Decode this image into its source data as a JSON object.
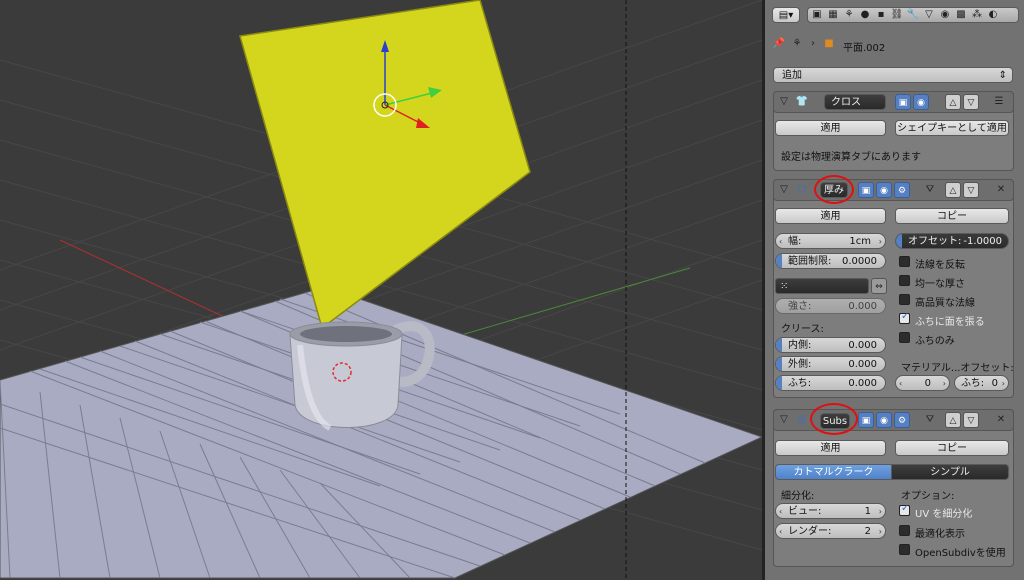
{
  "object_name": "平面.002",
  "add_modifier_label": "追加",
  "cloth": {
    "name": "クロス",
    "apply": "適用",
    "apply_shapekey": "シェイプキーとして適用",
    "note": "設定は物理演算タブにあります"
  },
  "solidify": {
    "name": "厚み",
    "apply": "適用",
    "copy": "コピー",
    "width_label": "幅:",
    "width_value": "1cm",
    "offset_label": "オフセット:",
    "offset_value": "-1.0000",
    "clamp_label": "範囲制限:",
    "clamp_value": "0.0000",
    "vgroup_value": "",
    "strength_label": "強さ:",
    "strength_value": "0.000",
    "crease_label": "クリース:",
    "inner_label": "内側:",
    "inner_value": "0.000",
    "outer_label": "外側:",
    "outer_value": "0.000",
    "rim_label": "ふち:",
    "rim_value": "0.000",
    "flip_normals": "法線を反転",
    "even_thickness": "均一な厚さ",
    "hq_normals": "高品質な法線",
    "fill_rim": "ふちに面を張る",
    "rim_only": "ふちのみ",
    "material_offset_label": "マテリアル...オフセット:",
    "mat_offset_value": "0",
    "mat_rim_label": "ふち:",
    "mat_rim_value": "0"
  },
  "subsurf": {
    "name": "Subs",
    "apply": "適用",
    "copy": "コピー",
    "tab_catmull": "カトマルクラーク",
    "tab_simple": "シンプル",
    "subdiv_label": "細分化:",
    "options_label": "オプション:",
    "view_label": "ビュー:",
    "view_value": "1",
    "render_label": "レンダー:",
    "render_value": "2",
    "uv_subdivide": "UV を細分化",
    "optimal_display": "最適化表示",
    "opensubdiv": "OpenSubdivを使用"
  },
  "colors": {
    "plane": "#d4d61e",
    "ground": "#a9abc2",
    "active_blue": "#5680c2",
    "annotation_red": "#e01010"
  }
}
